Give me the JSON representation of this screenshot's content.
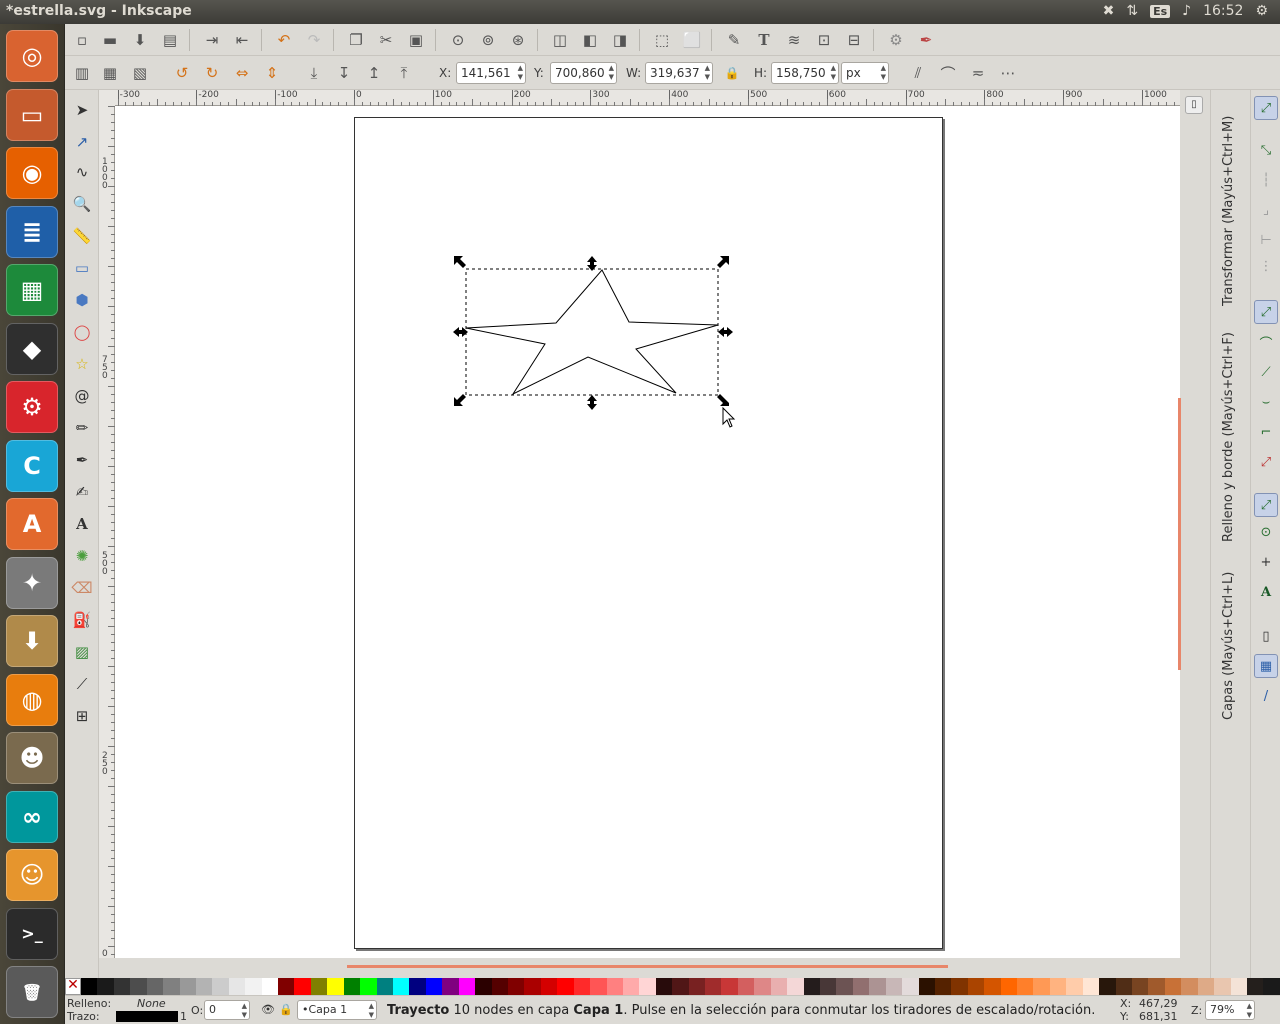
{
  "window": {
    "title": "*estrella.svg - Inkscape"
  },
  "tray": {
    "lang": "Es",
    "time": "16:52"
  },
  "launcher": [
    {
      "name": "ubuntu-dash-icon",
      "glyph": "◎",
      "bg": "#d96330"
    },
    {
      "name": "file-manager-icon",
      "glyph": "▭",
      "bg": "#c55a2d"
    },
    {
      "name": "firefox-icon",
      "glyph": "◉",
      "bg": "#e66000"
    },
    {
      "name": "writer-icon",
      "glyph": "≣",
      "bg": "#1f5fa8"
    },
    {
      "name": "calc-icon",
      "glyph": "▦",
      "bg": "#1d8a3b"
    },
    {
      "name": "inkscape-icon",
      "glyph": "◆",
      "bg": "#2f2f2f"
    },
    {
      "name": "freecad-icon",
      "glyph": "⚙",
      "bg": "#d8252c"
    },
    {
      "name": "codeblocks-icon",
      "glyph": "C",
      "bg": "#19a6d6"
    },
    {
      "name": "software-center-icon",
      "glyph": "A",
      "bg": "#e2692d"
    },
    {
      "name": "system-settings-icon",
      "glyph": "✦",
      "bg": "#7a7a7a"
    },
    {
      "name": "archive-manager-icon",
      "glyph": "⬇",
      "bg": "#b08a4a"
    },
    {
      "name": "blender-icon",
      "glyph": "◍",
      "bg": "#e87d0d"
    },
    {
      "name": "gimp-icon",
      "glyph": "☻",
      "bg": "#7a6a4e"
    },
    {
      "name": "arduino-icon",
      "glyph": "∞",
      "bg": "#00979c"
    },
    {
      "name": "scratch-icon",
      "glyph": "☺",
      "bg": "#e6952d"
    },
    {
      "name": "terminal-icon",
      "glyph": ">_",
      "bg": "#2b2b2b"
    },
    {
      "name": "trash-icon",
      "glyph": "🗑",
      "bg": "#5a5a5a"
    }
  ],
  "controls": {
    "x_label": "X:",
    "x_value": "141,561",
    "y_label": "Y:",
    "y_value": "700,860",
    "w_label": "W:",
    "w_value": "319,637",
    "h_label": "H:",
    "h_value": "158,750",
    "unit": "px"
  },
  "ruler": {
    "h_ticks": [
      "-300",
      "-200",
      "-100",
      "0",
      "100",
      "200",
      "300",
      "400",
      "500",
      "600",
      "700",
      "800",
      "900",
      "1000"
    ],
    "v_ticks": [
      "1000",
      "750",
      "500",
      "250",
      "0"
    ]
  },
  "dock": {
    "transform": "Transformar (Mayús+Ctrl+M)",
    "fill_stroke": "Relleno y borde (Mayús+Ctrl+F)",
    "layers": "Capas (Mayús+Ctrl+L)"
  },
  "palette": [
    "#000000",
    "#1a1a1a",
    "#333333",
    "#4d4d4d",
    "#666666",
    "#808080",
    "#999999",
    "#b3b3b3",
    "#cccccc",
    "#e6e6e6",
    "#f2f2f2",
    "#ffffff",
    "#800000",
    "#ff0000",
    "#808000",
    "#ffff00",
    "#008000",
    "#00ff00",
    "#008080",
    "#00ffff",
    "#000080",
    "#0000ff",
    "#800080",
    "#ff00ff",
    "#2b0000",
    "#550000",
    "#800000",
    "#aa0000",
    "#d40000",
    "#ff0000",
    "#ff2a2a",
    "#ff5555",
    "#ff8080",
    "#ffaaaa",
    "#ffd5d5",
    "#280b0b",
    "#501616",
    "#782121",
    "#a02c2c",
    "#c83737",
    "#d35f5f",
    "#de8787",
    "#e9afaf",
    "#f4d7d7",
    "#241c1c",
    "#483737",
    "#6c5353",
    "#916f6f",
    "#ac9393",
    "#c8b7b7",
    "#e3dbdb",
    "#2b1100",
    "#552200",
    "#803300",
    "#aa4400",
    "#d45500",
    "#ff6600",
    "#ff7f2a",
    "#ff9955",
    "#ffb380",
    "#ffccaa",
    "#ffe6d5",
    "#28170b",
    "#502d16",
    "#784421",
    "#a05a2c",
    "#c87137",
    "#d38d5f",
    "#deaa87",
    "#e9c6af",
    "#f4e3d7",
    "#241f1c",
    "#1a1a1a"
  ],
  "status": {
    "fill_label": "Relleno:",
    "fill_value": "None",
    "stroke_label": "Trazo:",
    "stroke_width": "1",
    "opacity_label": "O:",
    "opacity_value": "0",
    "layer": "•Capa 1",
    "msg_bold1": "Trayecto",
    "msg_mid": " 10 nodes en capa ",
    "msg_bold2": "Capa 1",
    "msg_tail": ". Pulse en la selección para conmutar los tiradores de escalado/rotación.",
    "cursor_x_label": "X:",
    "cursor_x": "467,29",
    "cursor_y_label": "Y:",
    "cursor_y": "681,31",
    "zoom_label": "Z:",
    "zoom_value": "79%"
  }
}
